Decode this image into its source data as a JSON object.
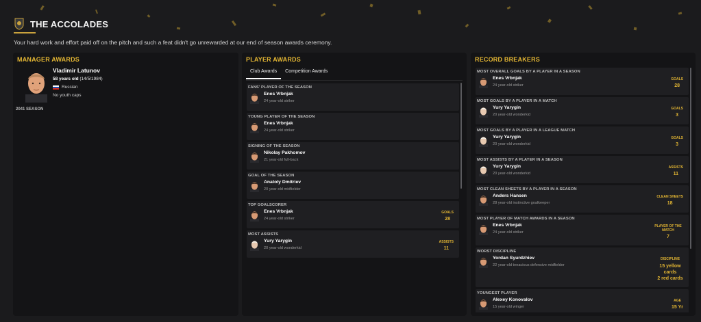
{
  "header": {
    "title": "THE ACCOLADES",
    "subtitle": "Your hard work and effort paid off on the pitch and such a feat didn't go unrewarded at our end of season awards ceremony."
  },
  "manager": {
    "section_title": "MANAGER AWARDS",
    "name": "Vladimir Latunov",
    "age": "58 years old",
    "dob": "(14/5/1984)",
    "nationality": "Russian",
    "caps": "No youth caps",
    "season": "2041 SEASON"
  },
  "player_awards": {
    "section_title": "PLAYER AWARDS",
    "tabs": [
      {
        "label": "Club Awards"
      },
      {
        "label": "Competition Awards"
      }
    ],
    "active_tab": "Club Awards",
    "items": [
      {
        "award": "FANS' PLAYER OF THE SEASON",
        "player": "Enes Vrbnjak",
        "desc": "24 year-old striker",
        "stat_label": "",
        "stat_value": ""
      },
      {
        "award": "YOUNG PLAYER OF THE SEASON",
        "player": "Enes Vrbnjak",
        "desc": "24 year-old striker",
        "stat_label": "",
        "stat_value": ""
      },
      {
        "award": "SIGNING OF THE SEASON",
        "player": "Nikolay Pakhomov",
        "desc": "21 year-old full-back",
        "stat_label": "",
        "stat_value": ""
      },
      {
        "award": "GOAL OF THE SEASON",
        "player": "Anatoly Dmitriev",
        "desc": "20 year-old midfielder",
        "stat_label": "",
        "stat_value": ""
      },
      {
        "award": "TOP GOALSCORER",
        "player": "Enes Vrbnjak",
        "desc": "24 year-old striker",
        "stat_label": "GOALS",
        "stat_value": "28"
      },
      {
        "award": "MOST ASSISTS",
        "player": "Yury Yarygin",
        "desc": "20 year-old wonderkid",
        "stat_label": "ASSISTS",
        "stat_value": "11"
      }
    ]
  },
  "record_breakers": {
    "section_title": "RECORD BREAKERS",
    "items": [
      {
        "record": "MOST OVERALL GOALS BY A PLAYER IN A SEASON",
        "player": "Enes Vrbnjak",
        "desc": "24 year-old striker",
        "stat_label": "GOALS",
        "stat_value": "28"
      },
      {
        "record": "MOST GOALS BY A PLAYER IN A MATCH",
        "player": "Yury Yarygin",
        "desc": "20 year-old wonderkid",
        "stat_label": "GOALS",
        "stat_value": "3"
      },
      {
        "record": "MOST GOALS BY A PLAYER IN A LEAGUE MATCH",
        "player": "Yury Yarygin",
        "desc": "20 year-old wonderkid",
        "stat_label": "GOALS",
        "stat_value": "3"
      },
      {
        "record": "MOST ASSISTS BY A PLAYER IN A SEASON",
        "player": "Yury Yarygin",
        "desc": "20 year-old wonderkid",
        "stat_label": "ASSISTS",
        "stat_value": "11"
      },
      {
        "record": "MOST CLEAN SHEETS BY A PLAYER IN A SEASON",
        "player": "Anders Hansen",
        "desc": "28 year-old instinctive goalkeeper",
        "stat_label": "CLEAN SHEETS",
        "stat_value": "18"
      },
      {
        "record": "MOST PLAYER OF MATCH AWARDS IN A SEASON",
        "player": "Enes Vrbnjak",
        "desc": "24 year-old striker",
        "stat_label": "PLAYER OF THE MATCH",
        "stat_value": "7"
      },
      {
        "record": "WORST DISCIPLINE",
        "player": "Yordan Syurdzhiev",
        "desc": "22 year-old tenacious defensive midfielder",
        "stat_label": "DISCIPLINE",
        "stat_value": "15 yellow cards\n2 red cards"
      },
      {
        "record": "YOUNGEST PLAYER",
        "player": "Alexey Konovalov",
        "desc": "15 year-old winger",
        "stat_label": "AGE",
        "stat_value": "15 Yr"
      }
    ]
  },
  "colors": {
    "accent": "#e2b533",
    "panel": "#141416",
    "card": "#1f1f22",
    "background": "#1b1b1d"
  }
}
